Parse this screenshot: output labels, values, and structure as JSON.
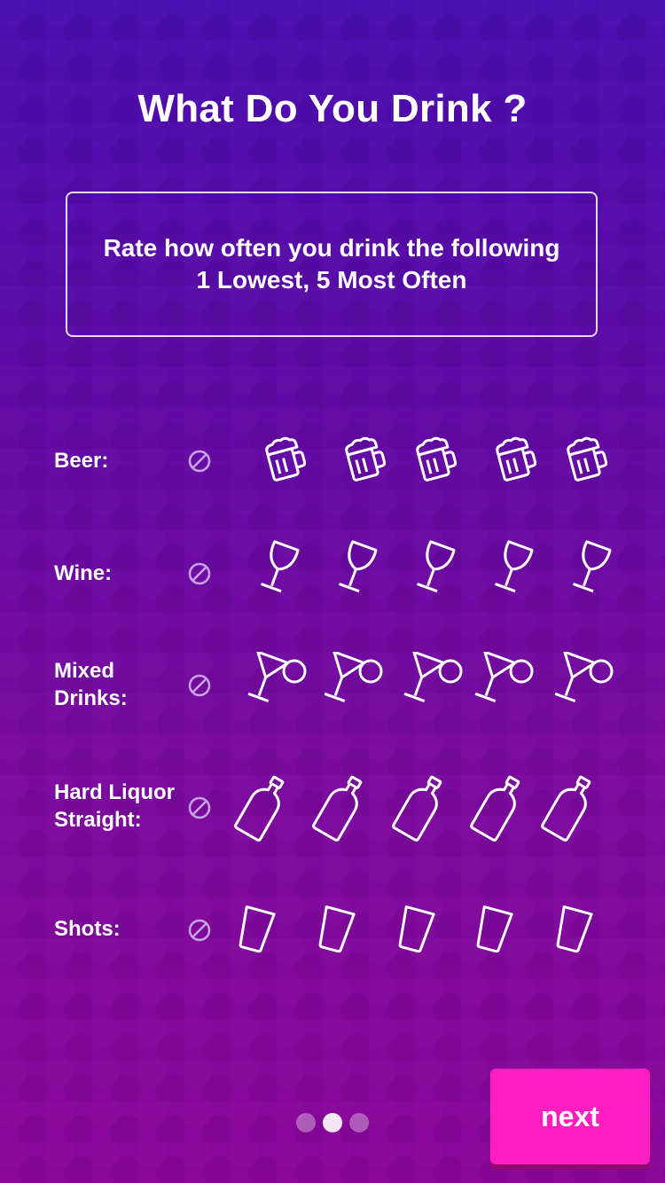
{
  "title": "What Do You Drink ?",
  "instruction": {
    "line1": "Rate how often you drink the following",
    "line2": "1 Lowest, 5 Most Often"
  },
  "ratings": [
    {
      "label_line1": "Beer:",
      "label_line2": "",
      "icon": "beer-mug-icon",
      "value": 0
    },
    {
      "label_line1": "Wine:",
      "label_line2": "",
      "icon": "wine-glass-icon",
      "value": 0
    },
    {
      "label_line1": "Mixed",
      "label_line2": "Drinks:",
      "icon": "cocktail-glass-icon",
      "value": 0
    },
    {
      "label_line1": "Hard Liquor",
      "label_line2": "Straight:",
      "icon": "liquor-bottle-icon",
      "value": 0
    },
    {
      "label_line1": "Shots:",
      "label_line2": "",
      "icon": "shot-glass-icon",
      "value": 0
    }
  ],
  "pager": {
    "pages": 3,
    "current": 2
  },
  "next_button": {
    "label": "next"
  },
  "colors": {
    "accent": "#ff1fc0",
    "bg_top": "#4a0fb0",
    "bg_bottom": "#8a079a"
  }
}
